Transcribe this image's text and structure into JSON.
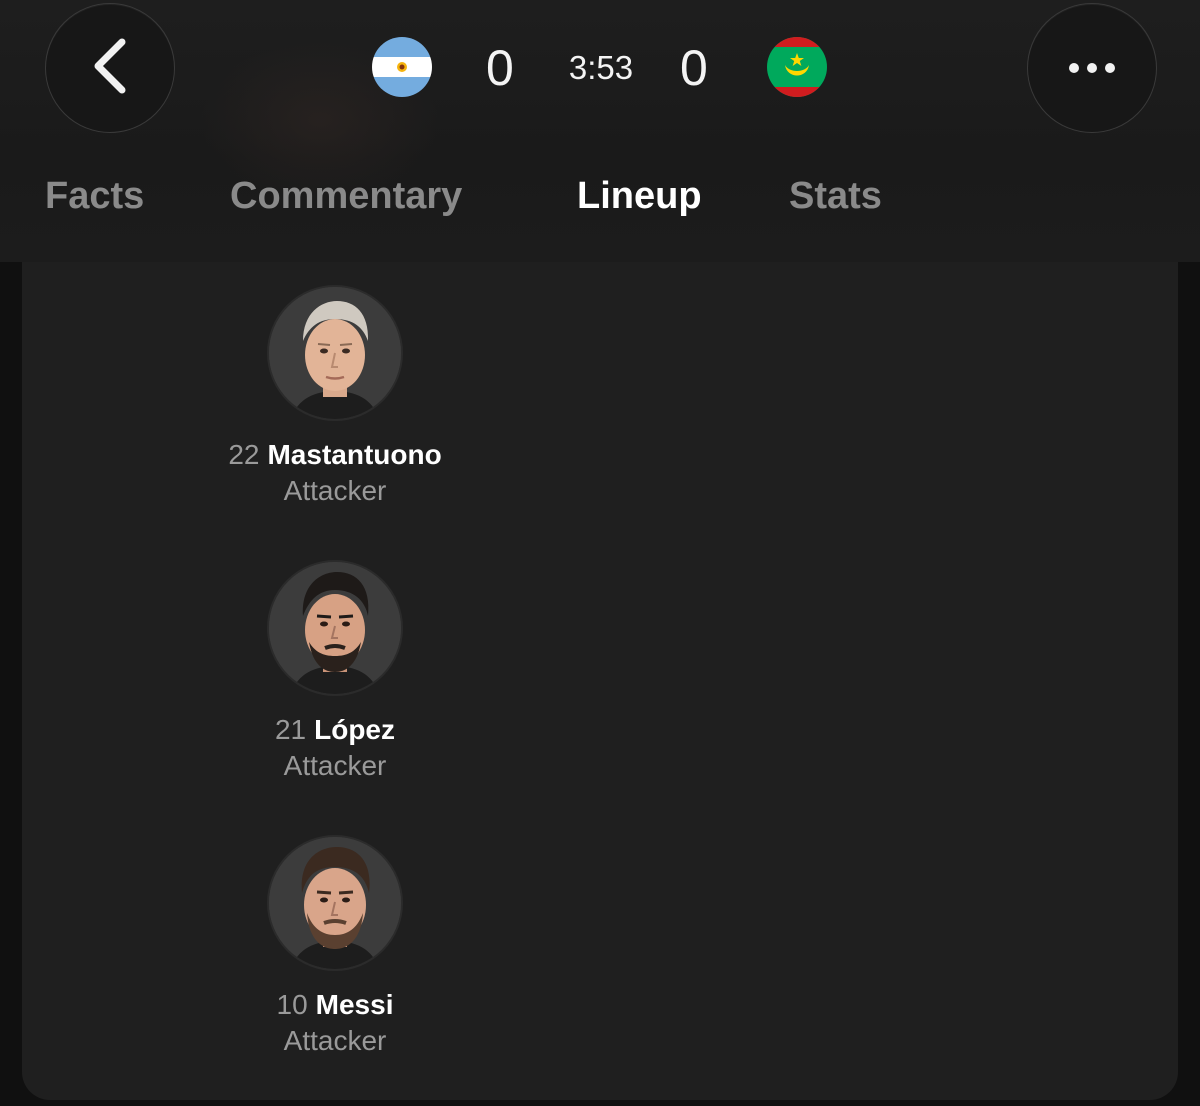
{
  "header": {
    "home_team": {
      "flag_icon": "argentina-flag-icon",
      "score": "0"
    },
    "away_team": {
      "flag_icon": "mauritania-flag-icon",
      "score": "0"
    },
    "clock": "3:53"
  },
  "tabs": [
    {
      "label": "Facts",
      "active": false
    },
    {
      "label": "Commentary",
      "active": false
    },
    {
      "label": "Lineup",
      "active": true
    },
    {
      "label": "Stats",
      "active": false
    }
  ],
  "players": [
    {
      "number": "22",
      "name": "Mastantuono",
      "position": "Attacker"
    },
    {
      "number": "21",
      "name": "López",
      "position": "Attacker"
    },
    {
      "number": "10",
      "name": "Messi",
      "position": "Attacker"
    }
  ],
  "colors": {
    "background": "#101010",
    "card": "#1f1f1f",
    "text_primary": "#ffffff",
    "text_secondary": "#9a9a9a",
    "tab_inactive": "#8a8a8a"
  }
}
